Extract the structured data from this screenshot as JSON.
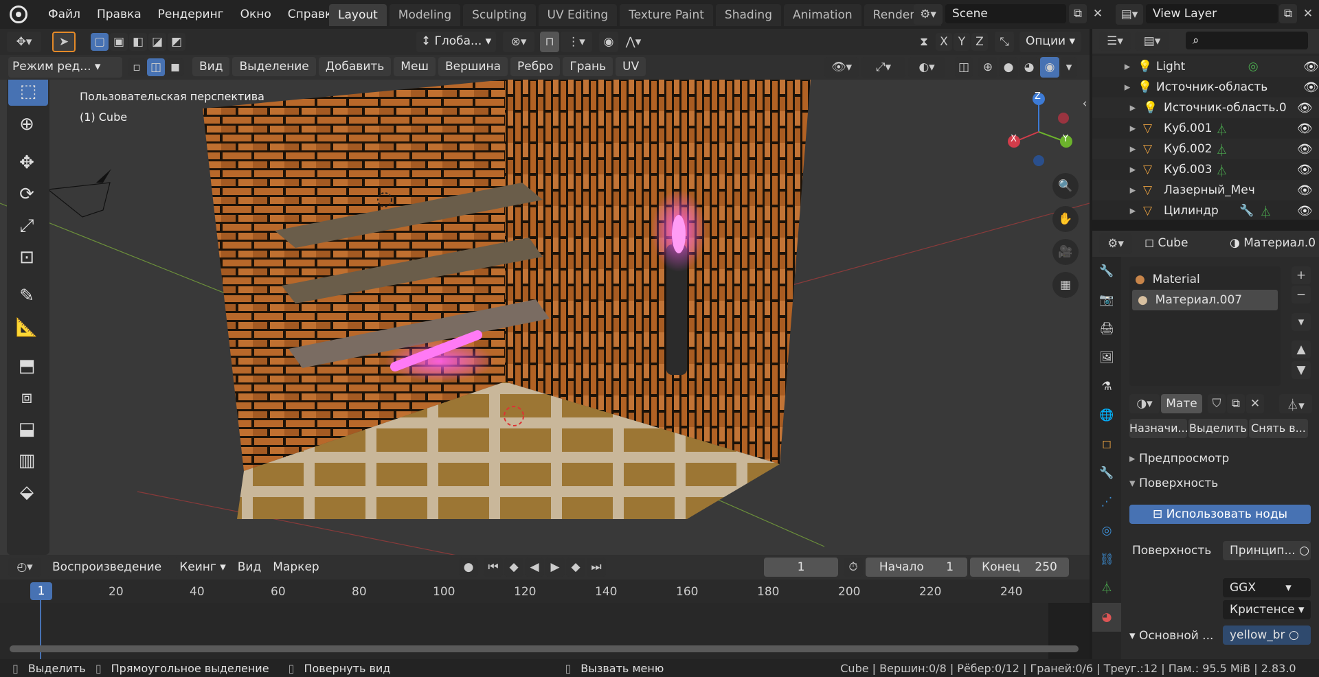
{
  "app": {
    "menu": [
      "Файл",
      "Правка",
      "Рендеринг",
      "Окно",
      "Справка"
    ]
  },
  "workspaces": [
    "Layout",
    "Modeling",
    "Sculpting",
    "UV Editing",
    "Texture Paint",
    "Shading",
    "Animation",
    "Rendering"
  ],
  "scene": {
    "name": "Scene",
    "view_layer": "View Layer"
  },
  "toolbar": {
    "orientation": "Глоба...",
    "options": "Опции",
    "axes": [
      "X",
      "Y",
      "Z"
    ]
  },
  "viewport_header": {
    "mode": "Режим ред...",
    "menus": [
      "Вид",
      "Выделение",
      "Добавить",
      "Меш",
      "Вершина",
      "Ребро",
      "Грань",
      "UV"
    ]
  },
  "viewport": {
    "title": "Пользовательская перспектива",
    "object": "(1) Cube",
    "gizmo": {
      "x": "X",
      "y": "Y",
      "z": "Z"
    }
  },
  "outliner": {
    "items": [
      {
        "label": "Light"
      },
      {
        "label": "Источник-область"
      },
      {
        "label": "Источник-область.0"
      },
      {
        "label": "Куб.001"
      },
      {
        "label": "Куб.002"
      },
      {
        "label": "Куб.003"
      },
      {
        "label": "Лазерный_Меч"
      },
      {
        "label": "Цилиндр"
      }
    ]
  },
  "properties": {
    "object": "Cube",
    "material_tab": "Материал.0",
    "materials": [
      "Material",
      "Материал.007"
    ],
    "slot_name": "Мате",
    "assign": "Назначи...",
    "select": "Выделить",
    "deselect": "Снять в...",
    "preview": "Предпросмотр",
    "surface_panel": "Поверхность",
    "use_nodes": "Использовать ноды",
    "surface_label": "Поверхность",
    "surface_value": "Принцип...",
    "distribution": "GGX",
    "subsurface": "Кристенсе",
    "base_label": "Основной ...",
    "base_value": "yellow_br"
  },
  "timeline": {
    "playback": "Воспроизведение",
    "keying": "Кеинг",
    "view": "Вид",
    "marker": "Маркер",
    "current_frame": "1",
    "start_label": "Начало",
    "start": "1",
    "end_label": "Конец",
    "end": "250",
    "ticks": [
      "1",
      "20",
      "40",
      "60",
      "80",
      "100",
      "120",
      "140",
      "160",
      "180",
      "200",
      "220",
      "240"
    ]
  },
  "statusbar": {
    "select": "Выделить",
    "box_select": "Прямоугольное выделение",
    "rotate": "Повернуть вид",
    "call_menu": "Вызвать меню",
    "stats": "Cube | Вершин:0/8 | Рёбер:0/12 | Граней:0/6 | Треуг.:12 | Пам.: 95.5 MiB | 2.83.0"
  },
  "colors": {
    "accent": "#4772b3",
    "bg": "#1d1d1d",
    "panel": "#303030"
  }
}
